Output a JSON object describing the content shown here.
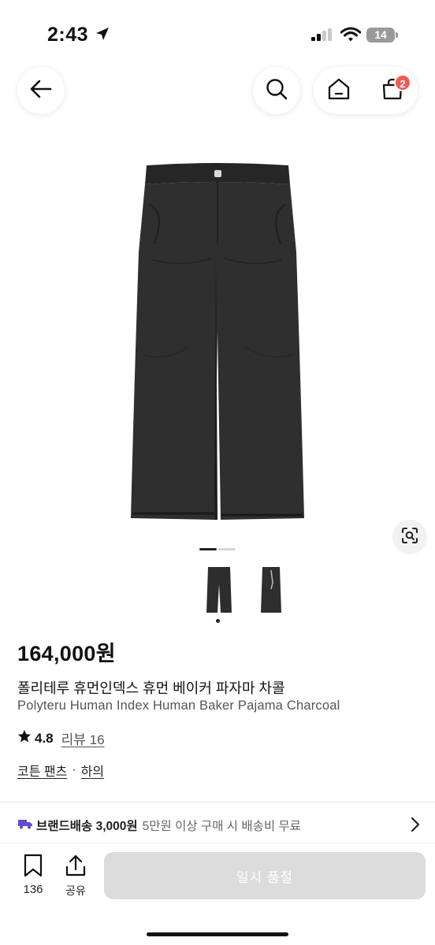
{
  "status": {
    "time": "2:43",
    "battery": "14"
  },
  "header": {
    "cart_count": "2"
  },
  "gallery": {
    "pager_total": 2,
    "pager_active": 1,
    "thumbnails": [
      "front-view",
      "side-view"
    ]
  },
  "product": {
    "price": "164,000원",
    "title_ko": "폴리테루 휴먼인덱스 휴먼 베이커 파자마 차콜",
    "title_en": "Polyteru Human Index Human Baker Pajama Charcoal",
    "rating": "4.8",
    "review_label": "리뷰 16",
    "category_main": "코튼 팬츠",
    "category_separator": "·",
    "category_sub": "하의"
  },
  "shipping": {
    "label": "브랜드배송 3,000원",
    "note": "5만원 이상 구매 시 배송비 무료"
  },
  "bottom_bar": {
    "wish_count": "136",
    "share_label": "공유",
    "soldout_label": "일시 품절"
  },
  "colors": {
    "badge": "#ef5a57",
    "truck": "#5b4fd1",
    "soldout_bg": "#dcdcdc",
    "product": "#2b2b2b"
  }
}
